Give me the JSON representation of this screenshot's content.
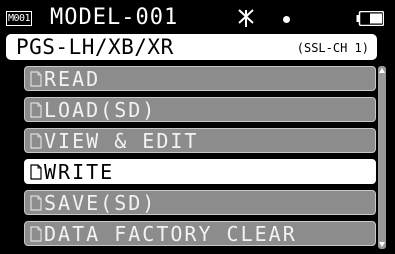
{
  "status": {
    "model_tag": "M001",
    "model_name": "MODEL-001"
  },
  "header": {
    "title": "PGS-LH/XB/XR",
    "channel": "(SSL-CH 1)"
  },
  "menu": {
    "items": [
      {
        "label": "READ"
      },
      {
        "label": "LOAD(SD)"
      },
      {
        "label": "VIEW & EDIT"
      },
      {
        "label": "WRITE"
      },
      {
        "label": "SAVE(SD)"
      },
      {
        "label": "DATA FACTORY CLEAR"
      }
    ],
    "selected_index": 3
  }
}
